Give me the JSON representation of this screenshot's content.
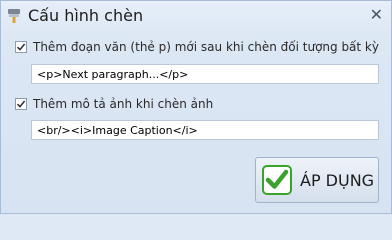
{
  "dialog": {
    "title": "Cấu hình chèn",
    "close_glyph": "✕",
    "title_icon": "brush-icon",
    "close_icon": "close-icon"
  },
  "options": [
    {
      "label": "Thêm đoạn văn (thẻ p) mới sau khi chèn đối tượng bất kỳ",
      "checked": true,
      "value": "<p>Next paragraph...</p>"
    },
    {
      "label": "Thêm mô tả ảnh khi chèn ảnh",
      "checked": true,
      "value": "<br/><i>Image Caption</i>"
    }
  ],
  "apply_button": {
    "label": "ÁP DỤNG",
    "icon": "checkmark-icon",
    "icon_color": "#3aa32e"
  }
}
